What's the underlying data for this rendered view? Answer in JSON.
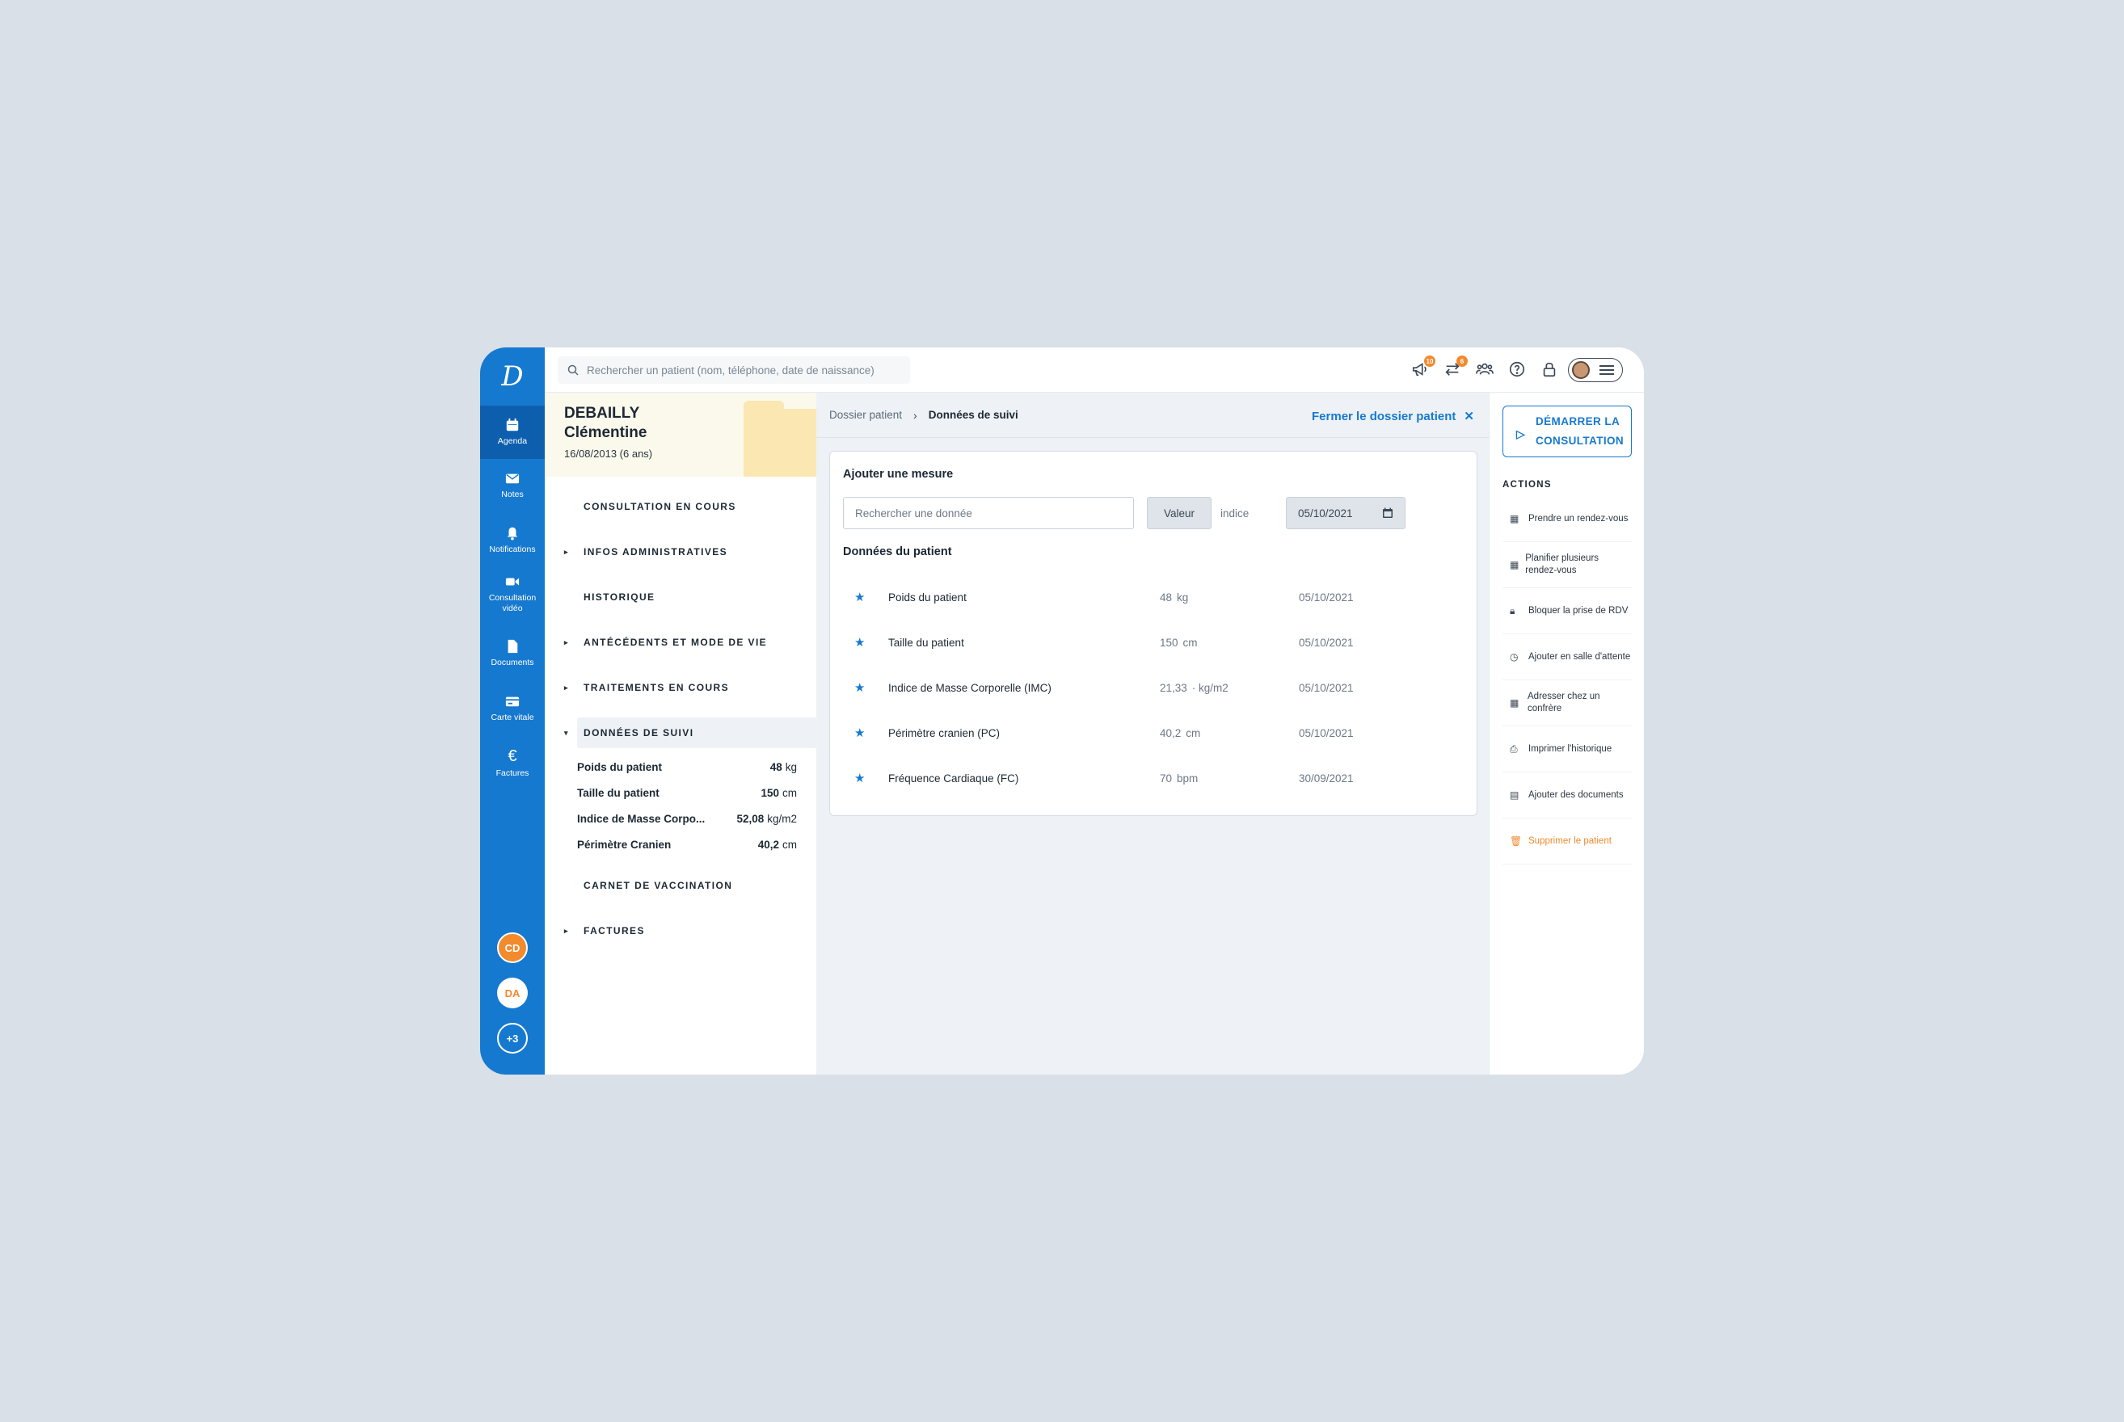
{
  "nav": {
    "logo": "D",
    "items": [
      {
        "label": "Agenda",
        "icon": "calendar-icon"
      },
      {
        "label": "Notes",
        "icon": "envelope-icon"
      },
      {
        "label": "Notifications",
        "icon": "bell-icon"
      },
      {
        "label": "Consultation vidéo",
        "icon": "video-icon"
      },
      {
        "label": "Documents",
        "icon": "document-icon"
      },
      {
        "label": "Carte vitale",
        "icon": "card-icon"
      },
      {
        "label": "Factures",
        "icon": "euro-icon",
        "glyph": "€"
      }
    ],
    "accounts": [
      "CD",
      "DA",
      "+3"
    ],
    "colors": {
      "bg": "#1679d0",
      "active": "#0d5fae"
    }
  },
  "topbar": {
    "search_placeholder": "Rechercher un patient (nom, téléphone, date de naissance)",
    "badges": {
      "megaphone": "10",
      "transfer": "6"
    }
  },
  "patient": {
    "last_name": "DEBAILLY",
    "first_name": "Clémentine",
    "dob": "16/08/2013 (6 ans)",
    "sections": [
      {
        "label": "CONSULTATION EN COURS",
        "arrow": ""
      },
      {
        "label": "INFOS ADMINISTRATIVES",
        "arrow": "▸"
      },
      {
        "label": "HISTORIQUE",
        "arrow": ""
      },
      {
        "label": "ANTÉCÉDENTS ET MODE DE VIE",
        "arrow": "▸"
      },
      {
        "label": "TRAITEMENTS EN COURS",
        "arrow": "▸"
      },
      {
        "label": "DONNÉES DE SUIVI",
        "arrow": "▾"
      },
      {
        "label": "CARNET DE VACCINATION",
        "arrow": ""
      },
      {
        "label": "FACTURES",
        "arrow": "▸"
      }
    ],
    "suivi": [
      {
        "label": "Poids du patient",
        "value": "48",
        "unit": "kg"
      },
      {
        "label": "Taille du patient",
        "value": "150",
        "unit": "cm"
      },
      {
        "label": "Indice de Masse Corpo...",
        "value": "52,08",
        "unit": "kg/m2"
      },
      {
        "label": "Périmètre Cranien",
        "value": "40,2",
        "unit": "cm"
      }
    ]
  },
  "main": {
    "breadcrumb": {
      "parent": "Dossier patient",
      "sep": "›",
      "current": "Données de suivi"
    },
    "close_label": "Fermer le dossier patient",
    "close_glyph": "✕",
    "add_title": "Ajouter une mesure",
    "search_placeholder": "Rechercher une donnée",
    "value_label": "Valeur",
    "indice_label": "indice",
    "date_value": "05/10/2021",
    "data_title": "Données du patient",
    "rows": [
      {
        "name": "Poids du patient",
        "value": "48",
        "unit": "kg",
        "date": "05/10/2021"
      },
      {
        "name": "Taille du patient",
        "value": "150",
        "unit": "cm",
        "date": "05/10/2021"
      },
      {
        "name": "Indice de Masse Corporelle (IMC)",
        "value": "21,33",
        "unit": "· kg/m2",
        "date": "05/10/2021"
      },
      {
        "name": "Périmètre cranien (PC)",
        "value": "40,2",
        "unit": "cm",
        "date": "05/10/2021"
      },
      {
        "name": "Fréquence Cardiaque (FC)",
        "value": "70",
        "unit": "bpm",
        "date": "30/09/2021"
      }
    ]
  },
  "actions": {
    "start_label": "DÉMARRER LA CONSULTATION",
    "title": "ACTIONS",
    "items": [
      {
        "label": "Prendre un rendez-vous",
        "icon": "calendar-icon",
        "glyph": "▦"
      },
      {
        "label": "Planifier plusieurs rendez-vous",
        "icon": "calendar-icon",
        "glyph": "▦"
      },
      {
        "label": "Bloquer la prise de RDV",
        "icon": "lock-icon",
        "glyph": "🔒︎"
      },
      {
        "label": "Ajouter en salle d'attente",
        "icon": "timer-icon",
        "glyph": "◷"
      },
      {
        "label": "Adresser chez un confrère",
        "icon": "calendar-icon",
        "glyph": "▦"
      },
      {
        "label": "Imprimer l'historique",
        "icon": "printer-icon",
        "glyph": "⎙"
      },
      {
        "label": "Ajouter des documents",
        "icon": "document-icon",
        "glyph": "▤"
      },
      {
        "label": "Supprimer le patient",
        "icon": "trash-icon",
        "glyph": "🗑︎"
      }
    ]
  }
}
